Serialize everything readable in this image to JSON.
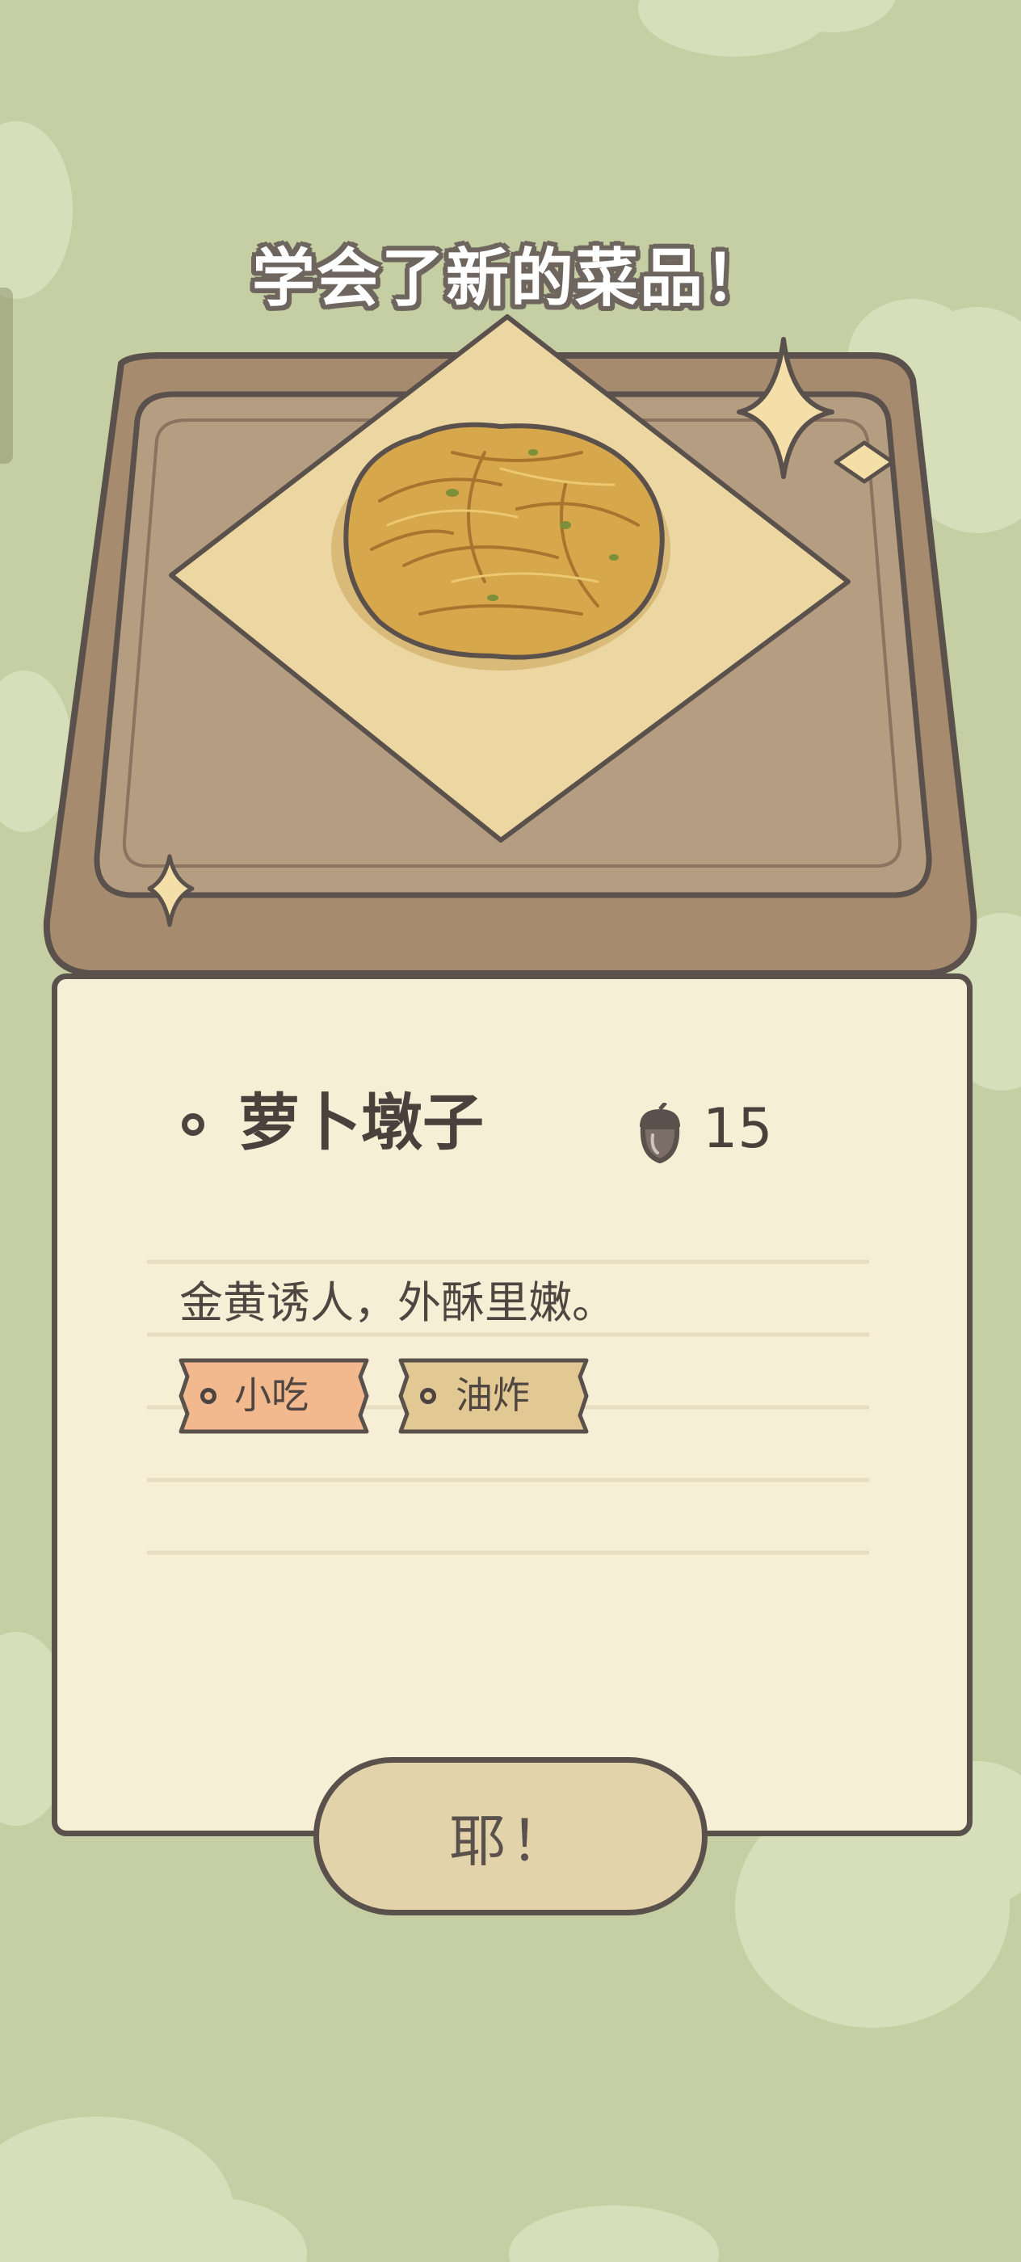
{
  "banner": {
    "title": "学会了新的菜品！"
  },
  "recipe": {
    "name": "萝卜墩子",
    "price": "15",
    "price_icon": "acorn-icon",
    "description": "金黄诱人，外酥里嫩。",
    "tags": [
      {
        "label": "小吃",
        "color": "#f2b88e"
      },
      {
        "label": "油炸",
        "color": "#e2c892"
      }
    ]
  },
  "confirm_button": {
    "label": "耶！"
  },
  "colors": {
    "background": "#c5cfa3",
    "card": "#f7eed6",
    "outline": "#5b514c",
    "tray": "#b09476",
    "button": "#e3d3ab"
  }
}
